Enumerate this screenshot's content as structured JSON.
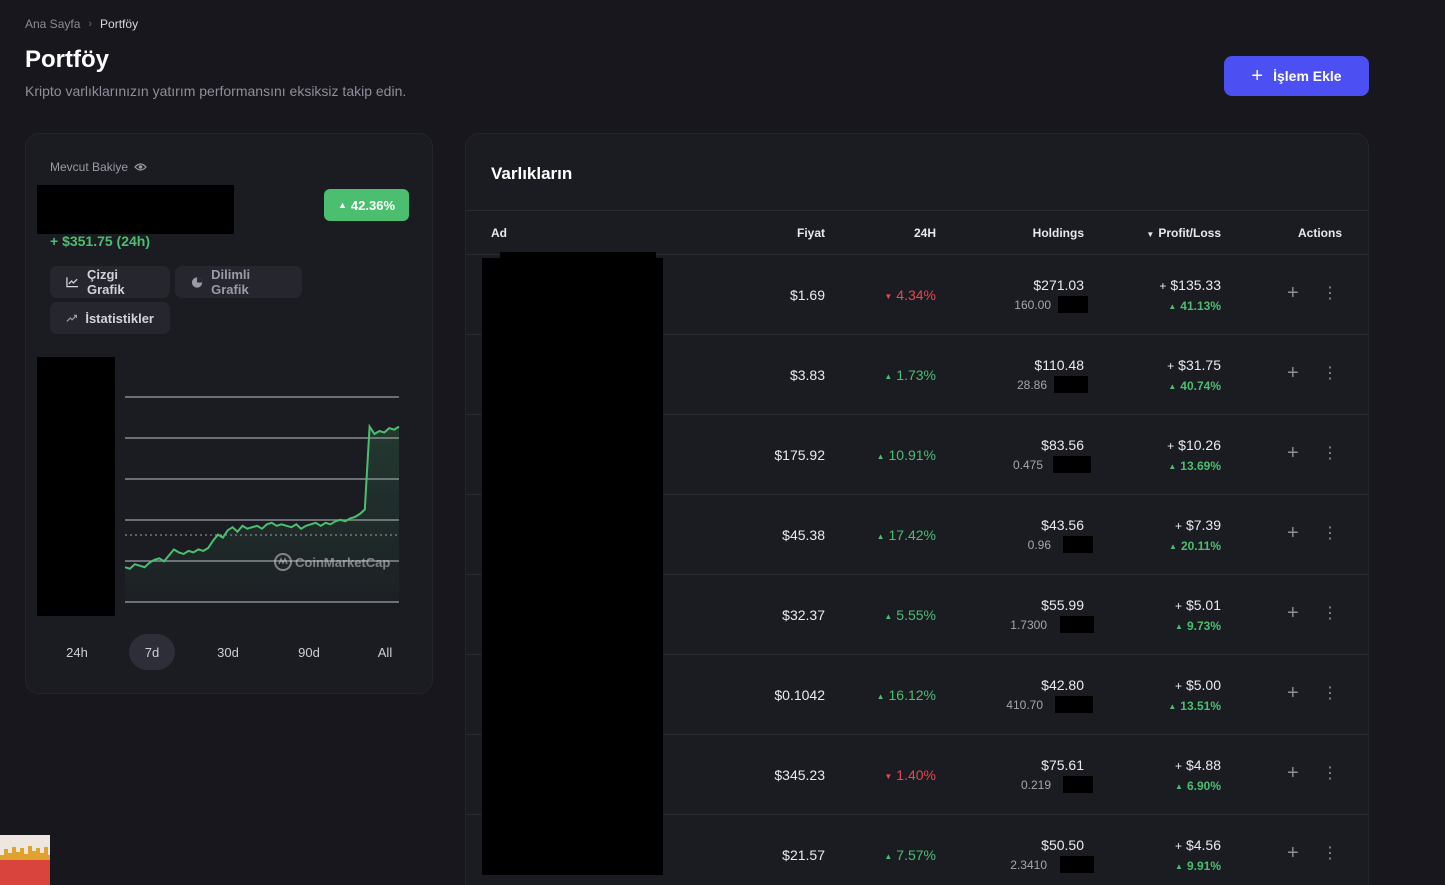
{
  "breadcrumb": {
    "home": "Ana Sayfa",
    "current": "Portföy"
  },
  "header": {
    "title": "Portföy",
    "subtitle": "Kripto varlıklarınızın yatırım performansını eksiksiz takip edin.",
    "add_button": "İşlem Ekle"
  },
  "balance": {
    "label": "Mevcut Bakiye",
    "change_pct": "42.36%",
    "change_24h": "+ $351.75 (24h)",
    "views": [
      "Çizgi Grafik",
      "Dilimli Grafik",
      "İstatistikler"
    ],
    "watermark": "CoinMarketCap",
    "ranges": [
      "24h",
      "7d",
      "30d",
      "90d",
      "All"
    ],
    "active_range": "7d"
  },
  "chart_data": {
    "type": "area",
    "series": [
      {
        "values": [
          0.1,
          0.09,
          0.12,
          0.11,
          0.1,
          0.13,
          0.15,
          0.16,
          0.14,
          0.18,
          0.22,
          0.2,
          0.19,
          0.21,
          0.2,
          0.22,
          0.21,
          0.23,
          0.28,
          0.32,
          0.3,
          0.35,
          0.37,
          0.34,
          0.38,
          0.36,
          0.37,
          0.38,
          0.36,
          0.39,
          0.4,
          0.38,
          0.39,
          0.38,
          0.37,
          0.39,
          0.36,
          0.38,
          0.39,
          0.4,
          0.38,
          0.4,
          0.39,
          0.41,
          0.42,
          0.41,
          0.43,
          0.44,
          0.46,
          0.49,
          1.05,
          1.0,
          1.02,
          1.01,
          1.04,
          1.03,
          1.05
        ]
      }
    ],
    "grid": true,
    "reference_line": true,
    "color": "#4bbf6f"
  },
  "assets": {
    "title": "Varlıkların",
    "columns": {
      "name": "Ad",
      "price": "Fiyat",
      "change": "24H",
      "holdings": "Holdings",
      "pl": "Profit/Loss",
      "actions": "Actions"
    },
    "rows": [
      {
        "price": "$1.69",
        "change": "4.34%",
        "dir": "down",
        "hold_val": "$271.03",
        "hold_qty": "160.00",
        "pl": "$135.33",
        "pl_pct": "41.13%"
      },
      {
        "price": "$3.83",
        "change": "1.73%",
        "dir": "up",
        "hold_val": "$110.48",
        "hold_qty": "28.86",
        "pl": "$31.75",
        "pl_pct": "40.74%"
      },
      {
        "price": "$175.92",
        "change": "10.91%",
        "dir": "up",
        "hold_val": "$83.56",
        "hold_qty": "0.475",
        "pl": "$10.26",
        "pl_pct": "13.69%"
      },
      {
        "price": "$45.38",
        "change": "17.42%",
        "dir": "up",
        "hold_val": "$43.56",
        "hold_qty": "0.96",
        "pl": "$7.39",
        "pl_pct": "20.11%"
      },
      {
        "price": "$32.37",
        "change": "5.55%",
        "dir": "up",
        "hold_val": "$55.99",
        "hold_qty": "1.7300",
        "pl": "$5.01",
        "pl_pct": "9.73%"
      },
      {
        "price": "$0.1042",
        "change": "16.12%",
        "dir": "up",
        "hold_val": "$42.80",
        "hold_qty": "410.70",
        "pl": "$5.00",
        "pl_pct": "13.51%"
      },
      {
        "price": "$345.23",
        "change": "1.40%",
        "dir": "down",
        "hold_val": "$75.61",
        "hold_qty": "0.219",
        "pl": "$4.88",
        "pl_pct": "6.90%"
      },
      {
        "price": "$21.57",
        "change": "7.57%",
        "dir": "up",
        "hold_val": "$50.50",
        "hold_qty": "2.3410",
        "pl": "$4.56",
        "pl_pct": "9.91%"
      }
    ]
  }
}
